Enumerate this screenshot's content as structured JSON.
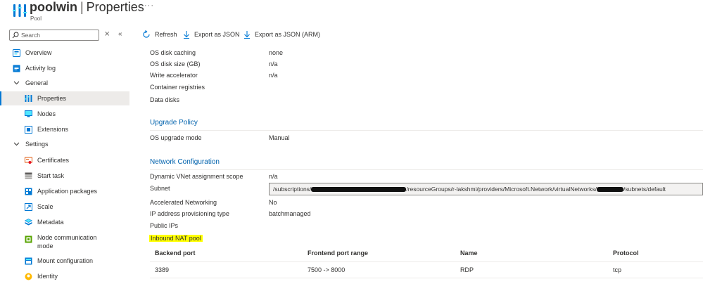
{
  "header": {
    "name": "poolwin",
    "section": "Properties",
    "subtitle": "Pool",
    "more": "···"
  },
  "sidebar": {
    "search_placeholder": "Search",
    "items": [
      {
        "label": "Overview"
      },
      {
        "label": "Activity log"
      },
      {
        "label": "General"
      },
      {
        "label": "Properties"
      },
      {
        "label": "Nodes"
      },
      {
        "label": "Extensions"
      },
      {
        "label": "Settings"
      },
      {
        "label": "Certificates"
      },
      {
        "label": "Start task"
      },
      {
        "label": "Application packages"
      },
      {
        "label": "Scale"
      },
      {
        "label": "Metadata"
      },
      {
        "label": "Node communication mode"
      },
      {
        "label": "Mount configuration"
      },
      {
        "label": "Identity"
      }
    ]
  },
  "toolbar": {
    "refresh": "Refresh",
    "export_json": "Export as JSON",
    "export_json_arm": "Export as JSON (ARM)"
  },
  "properties": {
    "os_disk_caching": {
      "label": "OS disk caching",
      "value": "none"
    },
    "os_disk_size": {
      "label": "OS disk size (GB)",
      "value": "n/a"
    },
    "write_accelerator": {
      "label": "Write accelerator",
      "value": "n/a"
    },
    "container_registries": {
      "label": "Container registries"
    },
    "data_disks": {
      "label": "Data disks"
    }
  },
  "upgrade_policy": {
    "title": "Upgrade Policy",
    "os_upgrade_mode": {
      "label": "OS upgrade mode",
      "value": "Manual"
    }
  },
  "network": {
    "title": "Network Configuration",
    "dynamic_vnet": {
      "label": "Dynamic VNet assignment scope",
      "value": "n/a"
    },
    "subnet": {
      "label": "Subnet",
      "part1": "/subscriptions/",
      "part2": "/resourceGroups/r-lakshmi/providers/Microsoft.Network/virtualNetworks/",
      "part3": "/subnets/default"
    },
    "accelerated_networking": {
      "label": "Accelerated Networking",
      "value": "No"
    },
    "ip_provisioning": {
      "label": "IP address provisioning type",
      "value": "batchmanaged"
    },
    "public_ips": {
      "label": "Public IPs"
    },
    "inbound_nat_pool": "Inbound NAT pool"
  },
  "nat_table": {
    "headers": [
      "Backend port",
      "Frontend port range",
      "Name",
      "Protocol"
    ],
    "rows": [
      [
        "3389",
        "7500 -> 8000",
        "RDP",
        "tcp"
      ]
    ]
  },
  "colors": {
    "accent": "#0078d4",
    "section_title": "#0062ad",
    "highlight": "#ffff00"
  }
}
